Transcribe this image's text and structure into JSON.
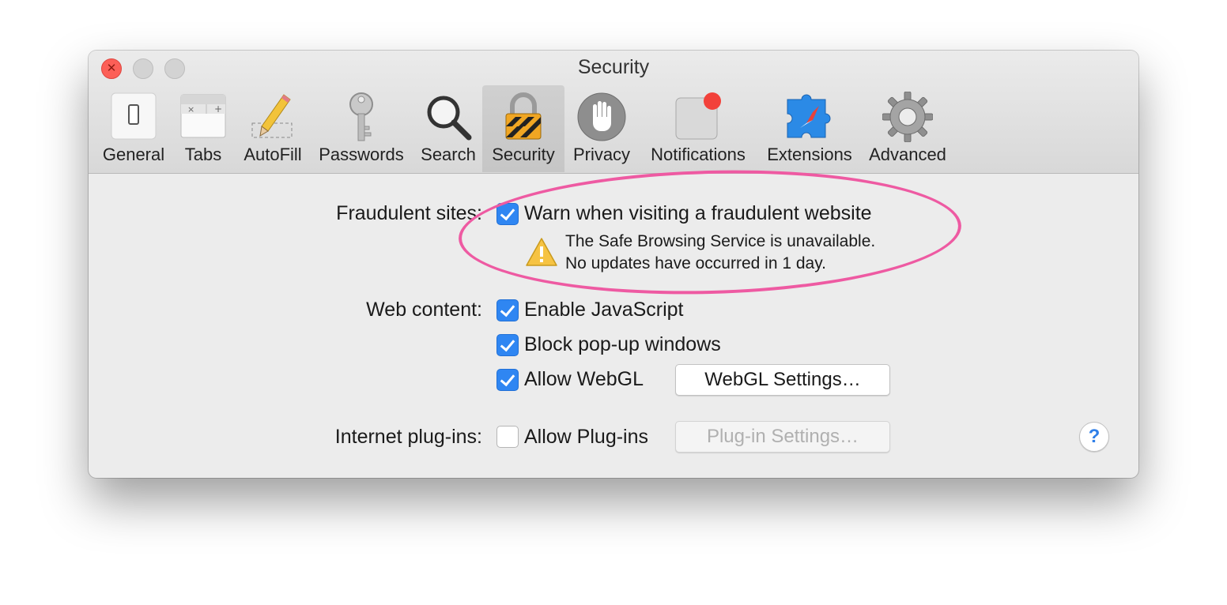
{
  "window": {
    "title": "Security"
  },
  "toolbar": {
    "items": [
      {
        "label": "General",
        "icon": "general-switch-icon"
      },
      {
        "label": "Tabs",
        "icon": "tabs-icon"
      },
      {
        "label": "AutoFill",
        "icon": "pencil-autofill-icon"
      },
      {
        "label": "Passwords",
        "icon": "key-icon"
      },
      {
        "label": "Search",
        "icon": "magnifier-icon"
      },
      {
        "label": "Security",
        "icon": "padlock-icon"
      },
      {
        "label": "Privacy",
        "icon": "hand-icon"
      },
      {
        "label": "Notifications",
        "icon": "notification-badge-icon"
      },
      {
        "label": "Extensions",
        "icon": "puzzle-compass-icon"
      },
      {
        "label": "Advanced",
        "icon": "gear-icon"
      }
    ],
    "selected": "Security"
  },
  "fraudulent": {
    "label": "Fraudulent sites:",
    "option": "Warn when visiting a fraudulent website",
    "checked": true,
    "warning_line1": "The Safe Browsing Service is unavailable.",
    "warning_line2": "No updates have occurred in 1 day."
  },
  "web_content": {
    "label": "Web content:",
    "options": [
      {
        "label": "Enable JavaScript",
        "checked": true
      },
      {
        "label": "Block pop-up windows",
        "checked": true
      },
      {
        "label": "Allow WebGL",
        "checked": true
      }
    ],
    "webgl_button": "WebGL Settings…"
  },
  "plugins": {
    "label": "Internet plug-ins:",
    "option": "Allow Plug-ins",
    "checked": false,
    "button": "Plug-in Settings…"
  },
  "help": {
    "label": "?"
  },
  "colors": {
    "accent": "#2f86f2",
    "close_button": "#fc5f57",
    "annotation_highlight": "#ee5aa2",
    "warning": "#f6c343"
  }
}
